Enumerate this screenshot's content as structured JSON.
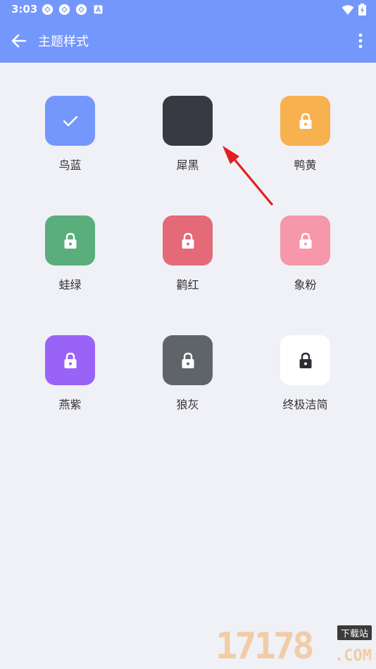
{
  "status_bar": {
    "time": "3:03",
    "notification_icons": [
      "sync-icon",
      "sync-icon",
      "sync-icon",
      "a-icon"
    ],
    "system_icons": [
      "wifi-icon",
      "battery-icon"
    ]
  },
  "app_bar": {
    "title": "主题样式",
    "background_color": "#7497fb"
  },
  "themes": [
    {
      "label": "鸟蓝",
      "color": "#7497fb",
      "state": "selected",
      "icon": "check-icon"
    },
    {
      "label": "犀黑",
      "color": "#373a42",
      "state": "unlocked",
      "icon": ""
    },
    {
      "label": "鸭黄",
      "color": "#f7b14f",
      "state": "locked",
      "icon": "lock-icon"
    },
    {
      "label": "蛙绿",
      "color": "#5aae7b",
      "state": "locked",
      "icon": "lock-icon"
    },
    {
      "label": "鹳红",
      "color": "#e46a77",
      "state": "locked",
      "icon": "lock-icon"
    },
    {
      "label": "象粉",
      "color": "#f697aa",
      "state": "locked",
      "icon": "lock-icon"
    },
    {
      "label": "燕紫",
      "color": "#9a63f7",
      "state": "locked",
      "icon": "lock-icon"
    },
    {
      "label": "狼灰",
      "color": "#5f6469",
      "state": "locked",
      "icon": "lock-icon"
    },
    {
      "label": "终极洁简",
      "color": "#ffffff",
      "state": "locked",
      "icon": "lock-icon"
    }
  ],
  "annotation": {
    "color": "#e02020",
    "icon": "red-arrow-icon"
  },
  "watermark": {
    "digits": "17178",
    "badge": "下载站",
    "suffix": ".COM"
  }
}
